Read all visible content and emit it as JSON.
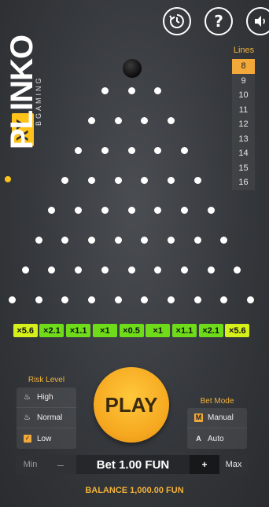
{
  "header": {
    "history_icon": "history-icon",
    "help_icon": "help-icon",
    "sound_icon": "sound-icon",
    "help_glyph": "?"
  },
  "logo": {
    "main": "PLINKO",
    "xy": "XY",
    "sub": "BGAMING"
  },
  "lines": {
    "title": "Lines",
    "options": [
      "8",
      "9",
      "10",
      "11",
      "12",
      "13",
      "14",
      "15",
      "16"
    ],
    "selected": "8"
  },
  "board": {
    "peg_rows": 8,
    "multipliers": [
      "×5.6",
      "×2.1",
      "×1.1",
      "×1",
      "×0.5",
      "×1",
      "×1.1",
      "×2.1",
      "×5.6"
    ]
  },
  "risk": {
    "title": "Risk Level",
    "options": [
      "High",
      "Normal",
      "Low"
    ],
    "selected": "Low"
  },
  "play": {
    "label": "PLAY"
  },
  "bet_mode": {
    "title": "Bet Mode",
    "options": [
      {
        "icon": "M",
        "label": "Manual"
      },
      {
        "icon": "A",
        "label": "Auto"
      }
    ],
    "selected": "Manual"
  },
  "bet_bar": {
    "min_label": "Min",
    "minus_label": "–",
    "bet_text": "Bet 1.00 FUN",
    "plus_label": "+",
    "max_label": "Max"
  },
  "balance": {
    "text": "BALANCE 1,000.00 FUN"
  },
  "colors": {
    "accent": "#f3a83a",
    "play": "#f5a820",
    "bucket_edge": "#d6f01a",
    "bucket_mid": "#6fdc1a"
  }
}
